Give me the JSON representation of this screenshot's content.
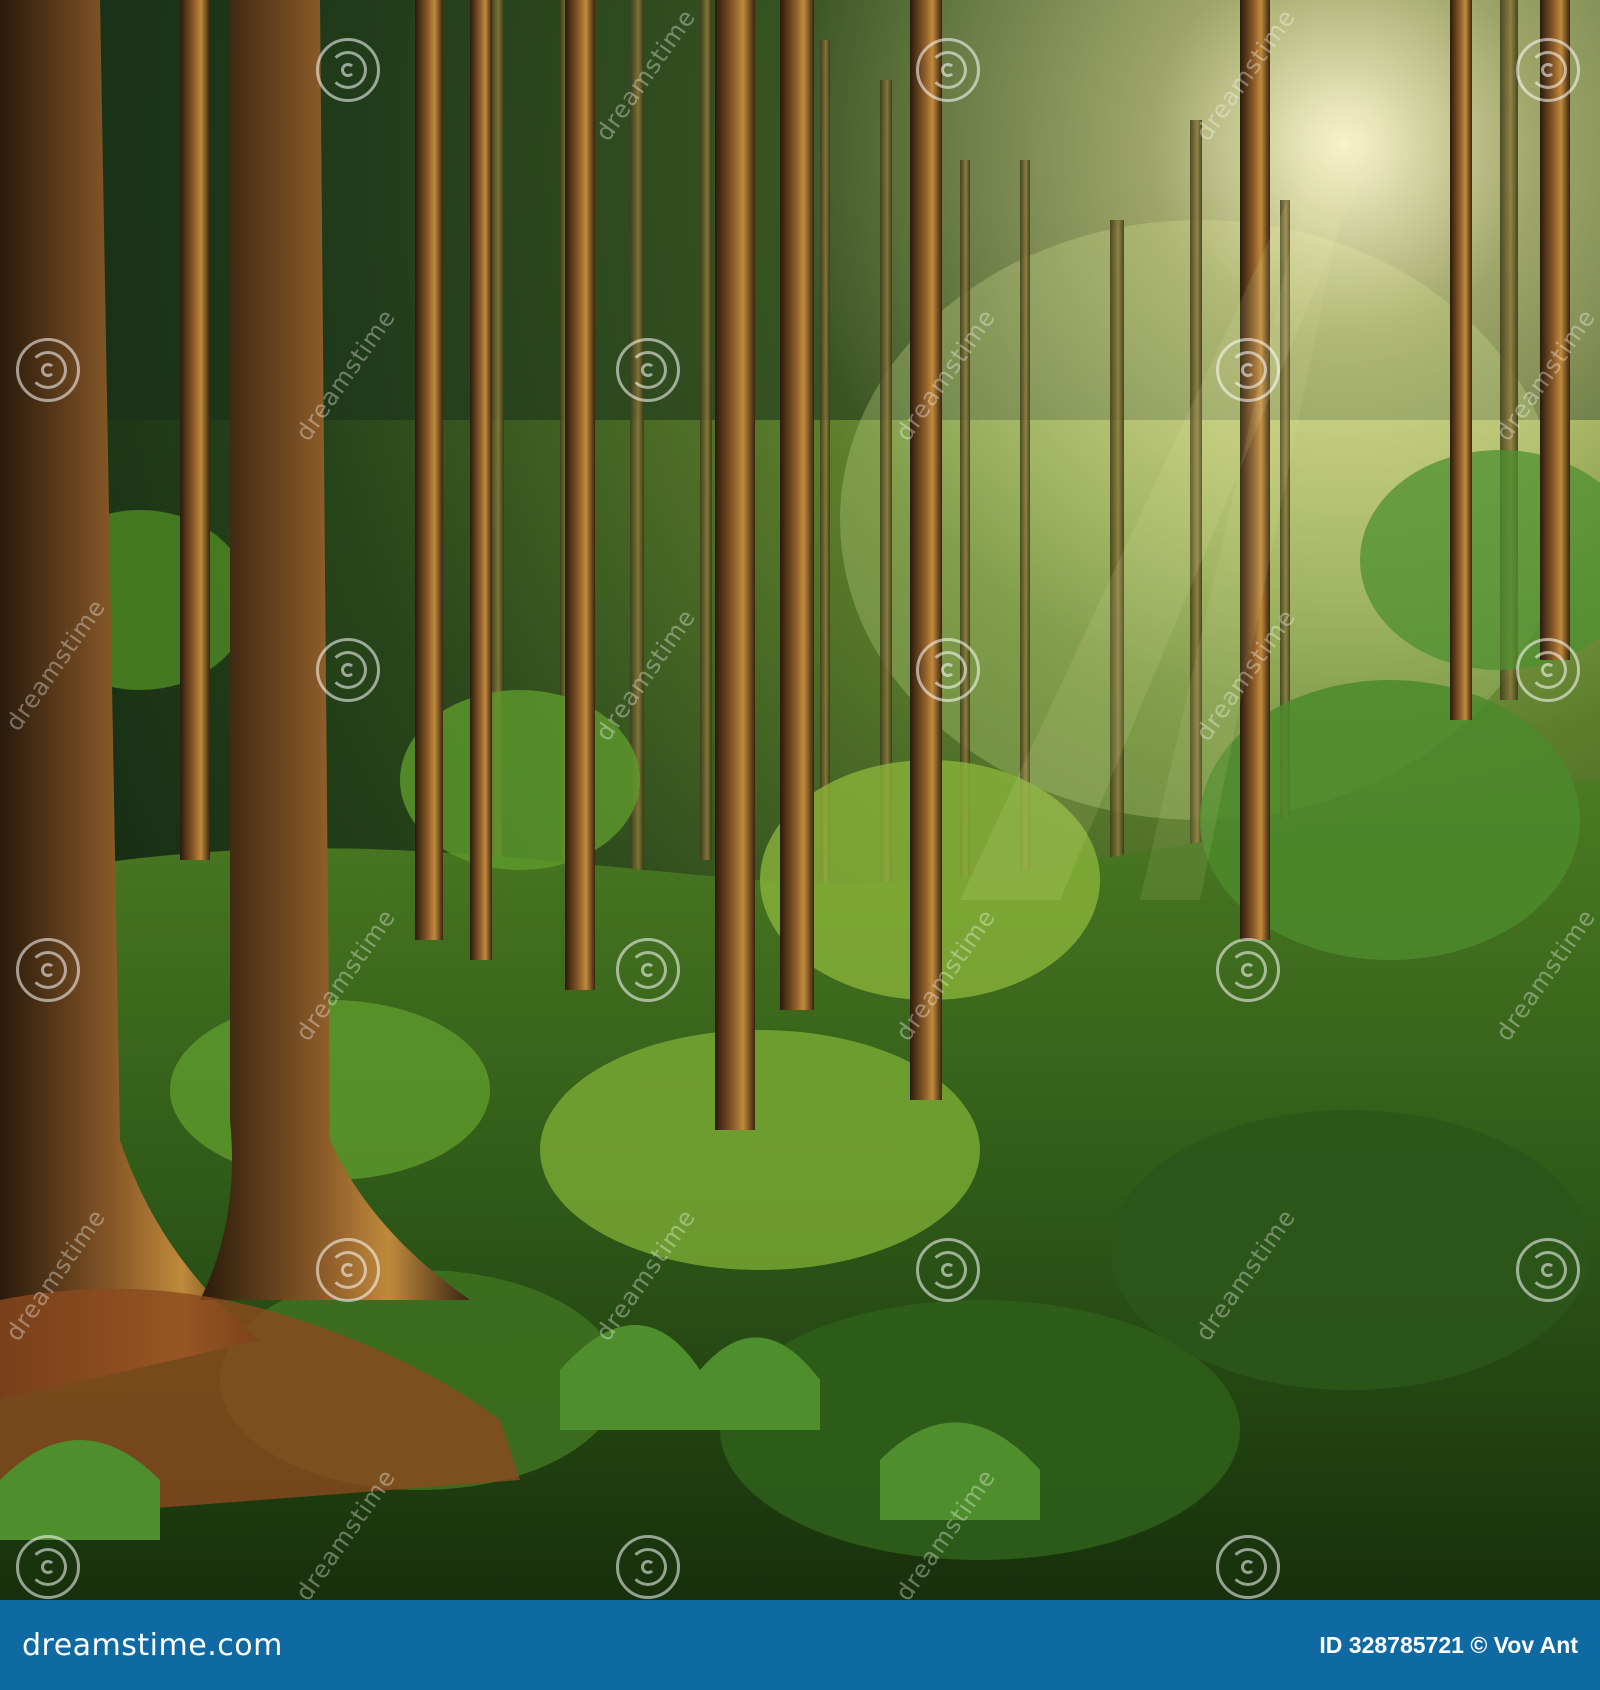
{
  "image": {
    "subject": "sunlit forest",
    "colors": {
      "canopy_dark": "#122612",
      "foliage": "#5d8d2c",
      "light": "#f3eeb0",
      "bark": "#5a3a1c",
      "banner": "#0f6aa3"
    }
  },
  "watermark": {
    "text": "dreamstime"
  },
  "banner": {
    "brand": "dreamstime.com",
    "credit": "ID 328785721 © Vov Ant"
  }
}
